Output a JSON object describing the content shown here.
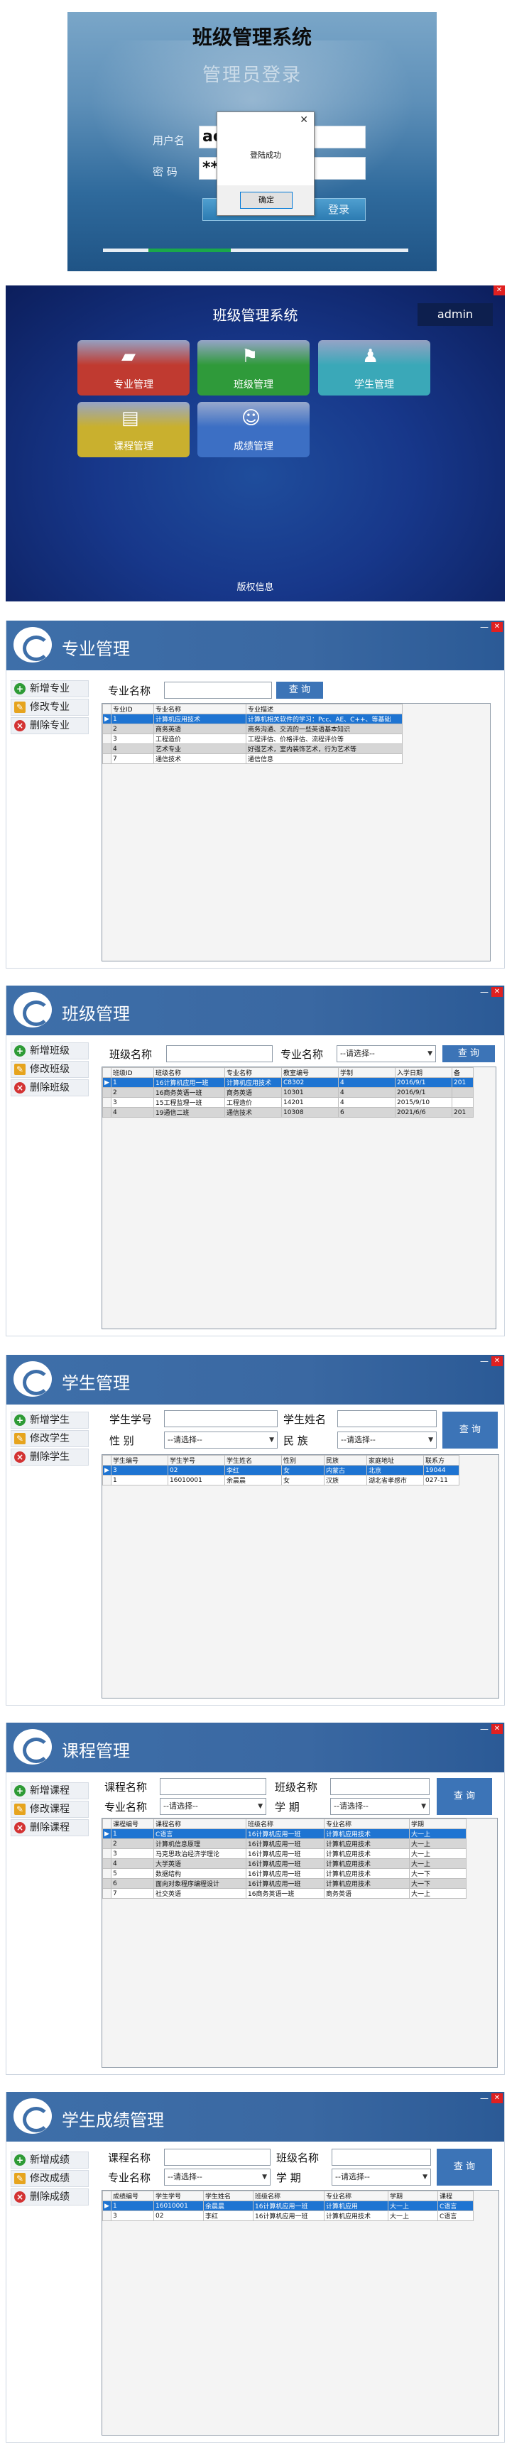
{
  "login": {
    "system_title": "班级管理系统",
    "subtitle": "管理员登录",
    "username_label": "用户名",
    "username_value": "ac",
    "password_label": "密  码",
    "password_value": "**",
    "login_button_label": "登录",
    "progress_fraction": 0.27,
    "dialog": {
      "message": "登陆成功",
      "ok_label": "确定",
      "close": "✕"
    }
  },
  "menu": {
    "title": "班级管理系统",
    "user": "admin",
    "tiles": [
      {
        "label": "专业管理",
        "icon": "folder-icon",
        "glyph": "▰",
        "color": "#c03a30"
      },
      {
        "label": "班级管理",
        "icon": "flag-icon",
        "glyph": "⚑",
        "color": "#2f9a3a"
      },
      {
        "label": "学生管理",
        "icon": "student-icon",
        "glyph": "♟",
        "color": "#3aa8b8"
      },
      {
        "label": "课程管理",
        "icon": "book-icon",
        "glyph": "▤",
        "color": "#c9b02e"
      },
      {
        "label": "成绩管理",
        "icon": "score-icon",
        "glyph": "☺",
        "color": "#3c6fc4"
      }
    ],
    "copyright": "版权信息"
  },
  "major": {
    "title": "专业管理",
    "buttons": [
      "新增专业",
      "修改专业",
      "删除专业"
    ],
    "search_label": "专业名称",
    "query": "查 询",
    "columns": [
      "专业ID",
      "专业名称",
      "专业描述"
    ],
    "rows": [
      [
        "1",
        "计算机应用技术",
        "计算机相关软件的学习：Pcc、AE、C++、等基础"
      ],
      [
        "2",
        "商务英语",
        "商务沟通、交流的一些英语基本知识"
      ],
      [
        "3",
        "工程造价",
        "工程评估、价格评估、流程评价等"
      ],
      [
        "4",
        "艺术专业",
        "好强艺术，室内装饰艺术，行为艺术等"
      ],
      [
        "7",
        "通信技术",
        "通信信息"
      ]
    ]
  },
  "class": {
    "title": "班级管理",
    "buttons": [
      "新增班级",
      "修改班级",
      "删除班级"
    ],
    "name_label": "班级名称",
    "major_label": "专业名称",
    "select_placeholder": "--请选择--",
    "query": "查 询",
    "columns": [
      "班级ID",
      "班级名称",
      "专业名称",
      "教室编号",
      "学制",
      "入学日期",
      "备"
    ],
    "rows": [
      [
        "1",
        "16计算机应用一班",
        "计算机应用技术",
        "C8302",
        "4",
        "2016/9/1",
        "201"
      ],
      [
        "2",
        "16商务英语一班",
        "商务英语",
        "10301",
        "4",
        "2016/9/1",
        ""
      ],
      [
        "3",
        "15工程监理一班",
        "工程造价",
        "14201",
        "4",
        "2015/9/10",
        ""
      ],
      [
        "4",
        "19通信二班",
        "通信技术",
        "10308",
        "6",
        "2021/6/6",
        "201"
      ]
    ]
  },
  "student": {
    "title": "学生管理",
    "buttons": [
      "新增学生",
      "修改学生",
      "删除学生"
    ],
    "no_label": "学生学号",
    "name_label": "学生姓名",
    "gender_label": "性    别",
    "nation_label": "民    族",
    "select_placeholder": "--请选择--",
    "query": "查 询",
    "columns": [
      "学生编号",
      "学生学号",
      "学生姓名",
      "性别",
      "民族",
      "家庭地址",
      "联系方"
    ],
    "rows": [
      [
        "3",
        "02",
        "李红",
        "女",
        "内蒙古",
        "北京",
        "19044"
      ],
      [
        "1",
        "16010001",
        "余晨晨",
        "女",
        "汉族",
        "湖北省孝感市",
        "027-11"
      ]
    ]
  },
  "course": {
    "title": "课程管理",
    "buttons": [
      "新增课程",
      "修改课程",
      "删除课程"
    ],
    "course_label": "课程名称",
    "class_label": "班级名称",
    "major_label": "专业名称",
    "term_label": "学    期",
    "select_placeholder": "--请选择--",
    "query": "查 询",
    "columns": [
      "课程编号",
      "课程名称",
      "班级名称",
      "专业名称",
      "学期"
    ],
    "rows": [
      [
        "1",
        "C语言",
        "16计算机应用一班",
        "计算机应用技术",
        "大一上"
      ],
      [
        "2",
        "计算机信息原理",
        "16计算机应用一班",
        "计算机应用技术",
        "大一上"
      ],
      [
        "3",
        "马克思政治经济学理论",
        "16计算机应用一班",
        "计算机应用技术",
        "大一上"
      ],
      [
        "4",
        "大学英语",
        "16计算机应用一班",
        "计算机应用技术",
        "大一上"
      ],
      [
        "5",
        "数据结构",
        "16计算机应用一班",
        "计算机应用技术",
        "大一下"
      ],
      [
        "6",
        "面向对象程序编程设计",
        "16计算机应用一班",
        "计算机应用技术",
        "大一下"
      ],
      [
        "7",
        "社交英语",
        "16商务英语一班",
        "商务英语",
        "大一上"
      ]
    ]
  },
  "score": {
    "title": "学生成绩管理",
    "buttons": [
      "新增成绩",
      "修改成绩",
      "删除成绩"
    ],
    "course_label": "课程名称",
    "class_label": "班级名称",
    "major_label": "专业名称",
    "term_label": "学    期",
    "select_placeholder": "--请选择--",
    "query": "查 询",
    "columns": [
      "成绩编号",
      "学生学号",
      "学生姓名",
      "班级名称",
      "专业名称",
      "学期",
      "课程"
    ],
    "rows": [
      [
        "1",
        "16010001",
        "余晨晨",
        "16计算机应用一班",
        "计算机应用",
        "大一上",
        "C语言"
      ],
      [
        "3",
        "02",
        "李红",
        "16计算机应用一班",
        "计算机应用技术",
        "大一上",
        "C语言"
      ]
    ]
  },
  "window_controls": {
    "minimize": "—",
    "close": "✕"
  }
}
